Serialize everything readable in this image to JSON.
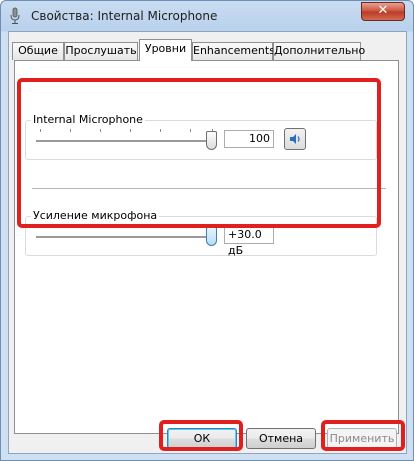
{
  "window": {
    "title": "Свойства: Internal Microphone",
    "close_label": "✕"
  },
  "tabs": [
    {
      "label": "Общие",
      "active": false
    },
    {
      "label": "Прослушать",
      "active": false
    },
    {
      "label": "Уровни",
      "active": true
    },
    {
      "label": "Enhancements",
      "active": false
    },
    {
      "label": "Дополнительно",
      "active": false
    }
  ],
  "levels": {
    "microphone": {
      "label": "Internal Microphone",
      "value": "100",
      "level": 1.0,
      "mute_icon": "speaker-icon"
    },
    "boost": {
      "label": "Усиление микрофона",
      "value": "+30.0 дБ",
      "level": 1.0
    }
  },
  "buttons": {
    "ok": "ОК",
    "cancel": "Отмена",
    "apply": "Применить"
  },
  "colors": {
    "highlight": "#e0201f",
    "titlebar": "#b9d1ec",
    "close": "#c9503a"
  }
}
